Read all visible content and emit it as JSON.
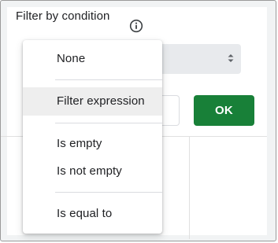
{
  "filter": {
    "title": "Filter by condition",
    "ok_label": "OK"
  },
  "menu": {
    "items": [
      {
        "label": "None"
      },
      {
        "label": "Filter expression"
      },
      {
        "label": "Is empty"
      },
      {
        "label": "Is not empty"
      },
      {
        "label": "Is equal to"
      }
    ],
    "highlighted": "Filter expression"
  },
  "colors": {
    "ok_button": "#188038",
    "select_background": "#e8eaed",
    "highlight": "#eeeeee"
  },
  "icons": {
    "info": "info-icon",
    "select": "select-arrows-icon"
  }
}
